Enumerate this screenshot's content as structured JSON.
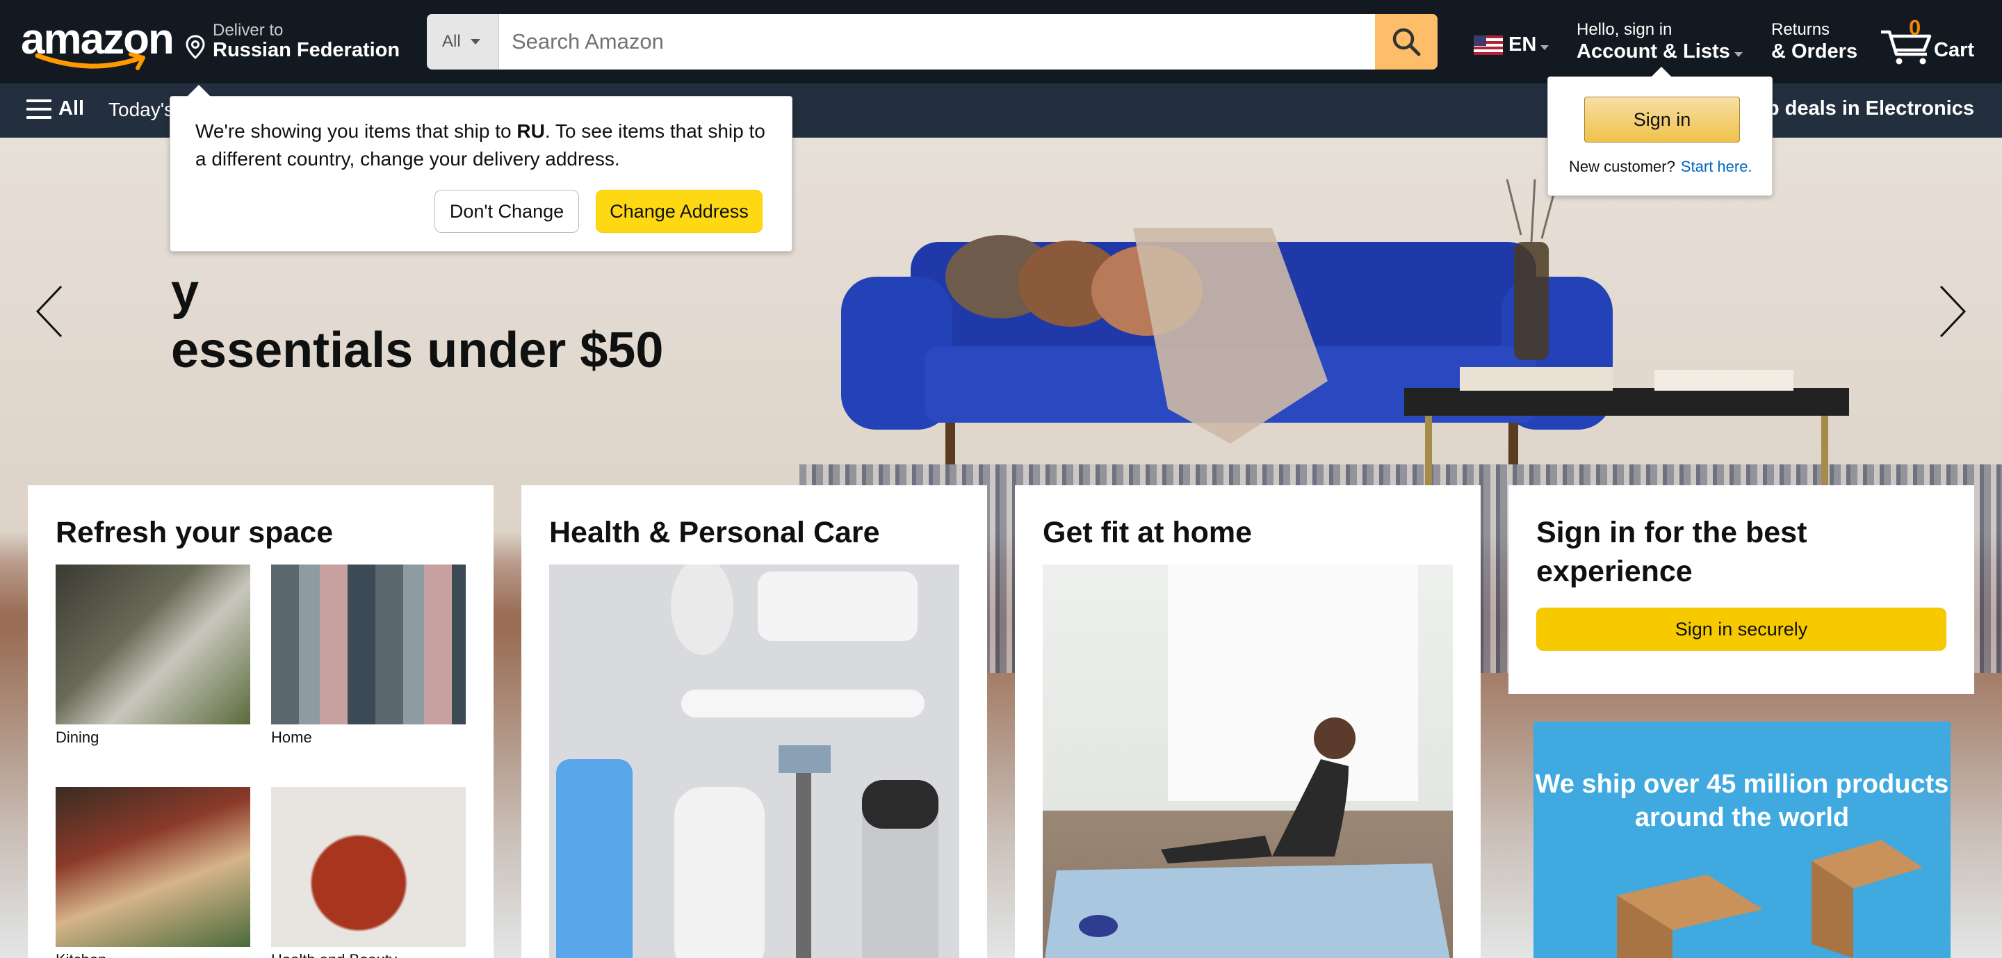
{
  "header": {
    "logo_text": "amazon",
    "deliver_to_label": "Deliver to",
    "deliver_to_country": "Russian Federation",
    "search": {
      "category": "All",
      "placeholder": "Search Amazon"
    },
    "language": "EN",
    "account_greeting": "Hello, sign in",
    "account_label": "Account & Lists",
    "returns_label": "Returns",
    "orders_label": "& Orders",
    "cart_count": "0",
    "cart_label": "Cart"
  },
  "nav": {
    "all_label": "All",
    "today_label": "Today's",
    "promo_label": "p deals in Electronics"
  },
  "hero": {
    "title_line1": "y",
    "title_line2": "essentials under $50"
  },
  "delivery_popover": {
    "message_part1": "We're showing you items that ship to ",
    "message_bold": "RU",
    "message_part2": ". To see items that ship to a different country, change your delivery address.",
    "dont_change_label": "Don't Change",
    "change_address_label": "Change Address"
  },
  "account_popover": {
    "sign_in_label": "Sign in",
    "new_customer_label": "New customer?",
    "start_here_label": "Start here."
  },
  "cards": {
    "refresh": {
      "title": "Refresh your space",
      "tiles": [
        {
          "caption": "Dining"
        },
        {
          "caption": "Home"
        },
        {
          "caption": "Kitchen"
        },
        {
          "caption": "Health and Beauty"
        }
      ]
    },
    "health": {
      "title": "Health & Personal Care"
    },
    "fit": {
      "title": "Get fit at home"
    },
    "signin": {
      "title": "Sign in for the best experience",
      "button_label": "Sign in securely"
    }
  },
  "ship_ad": {
    "text": "We ship over 45 million products around the world"
  },
  "colors": {
    "header_bg": "#131921",
    "nav_bg": "#232f3e",
    "search_button": "#febd69",
    "cart_count": "#f08804",
    "primary_button": "#ffd814",
    "link": "#0066c0",
    "ship_ad_bg": "#3fa9e0"
  }
}
